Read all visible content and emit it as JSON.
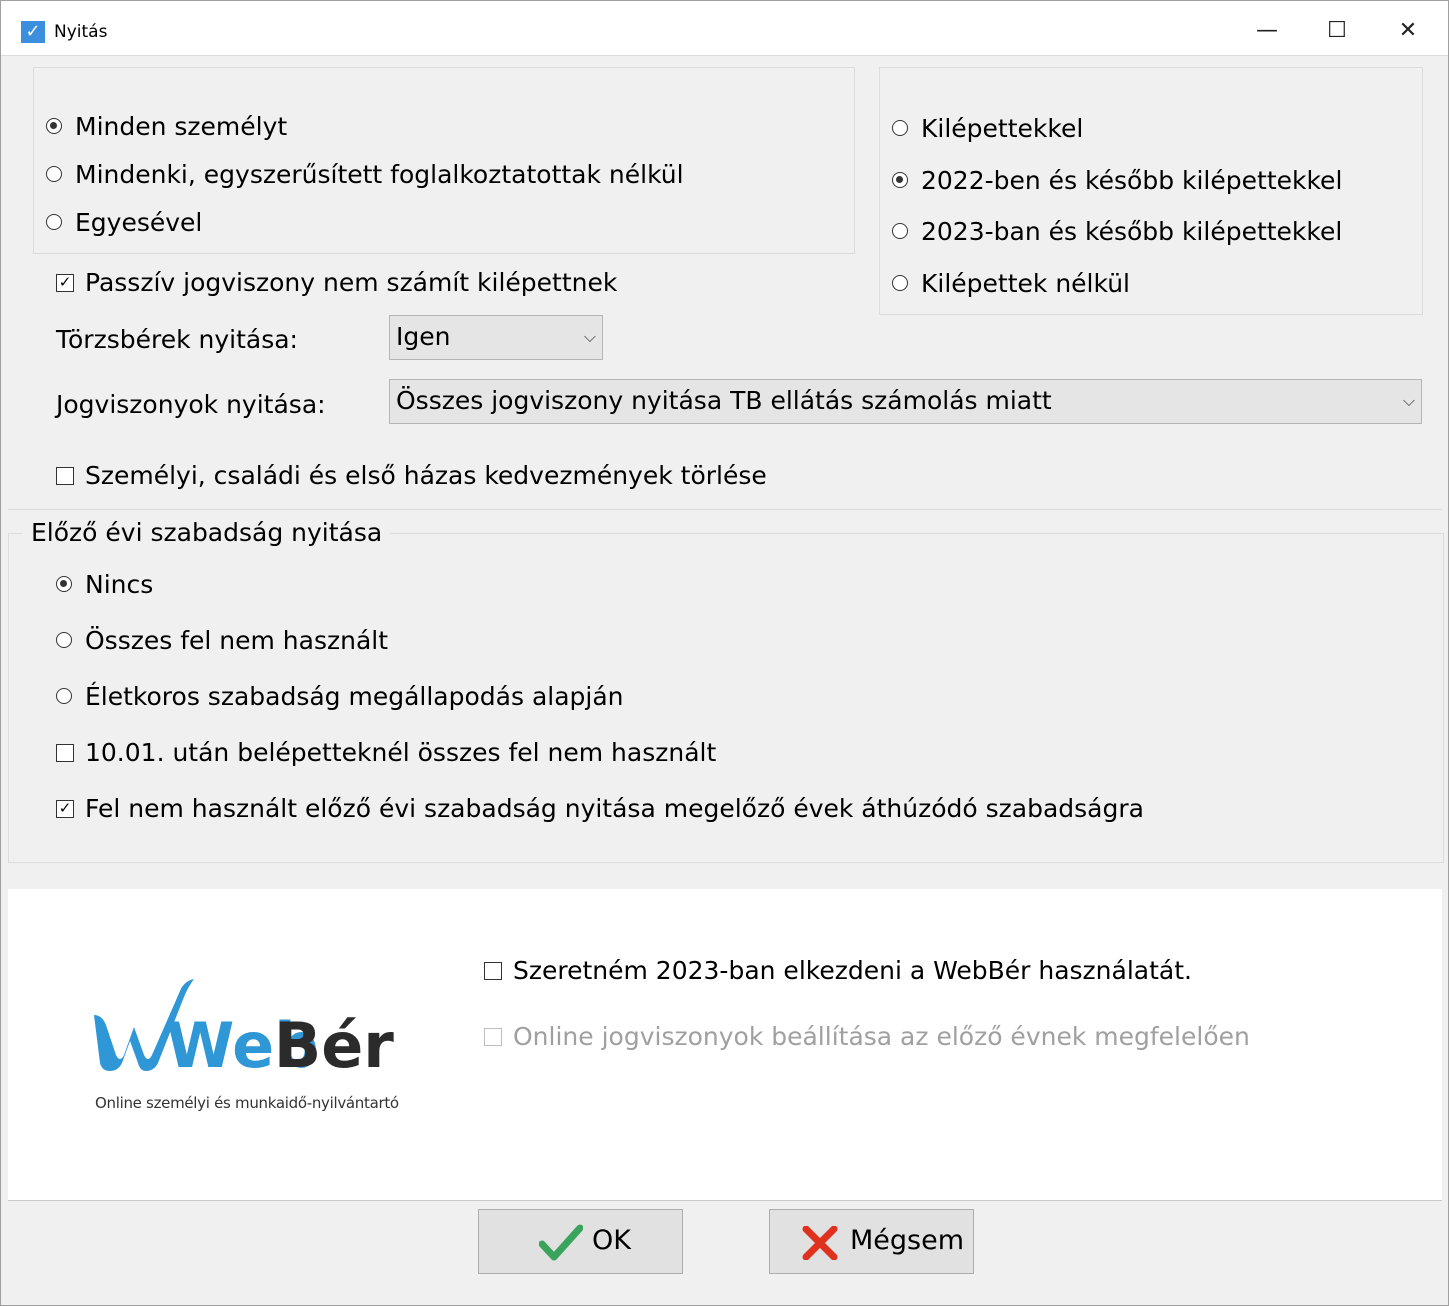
{
  "window": {
    "title": "Nyitás",
    "app_icon": "check-icon",
    "controls": {
      "minimize": "—",
      "maximize": "☐",
      "close": "✕"
    }
  },
  "person_scope": {
    "options": [
      "Minden személyt",
      "Mindenki, egyszerűsített foglalkoztatottak nélkül",
      "Egyesével"
    ],
    "selected_index": 0
  },
  "leavers": {
    "options": [
      "Kilépettekkel",
      "2022-ben és később kilépettekkel",
      "2023-ban és később kilépettekkel",
      "Kilépettek nélkül"
    ],
    "selected_index": 1
  },
  "passive_checkbox": {
    "label": "Passzív jogviszony nem számít kilépettnek",
    "checked": true
  },
  "torzsberek": {
    "label": "Törzsbérek nyitása:",
    "value": "Igen"
  },
  "jogviszonyok": {
    "label": "Jogviszonyok nyitása:",
    "value": "Összes jogviszony nyitása TB ellátás számolás miatt"
  },
  "delete_discounts_checkbox": {
    "label": "Személyi, családi és első házas kedvezmények törlése",
    "checked": false
  },
  "vacation": {
    "legend": "Előző évi szabadság nyitása",
    "options": [
      "Nincs",
      "Összes fel nem használt",
      "Életkoros szabadság megállapodás alapján"
    ],
    "selected_index": 0,
    "checkboxes": [
      {
        "label": "10.01. után belépetteknél összes fel nem használt",
        "checked": false
      },
      {
        "label": "Fel nem használt előző évi szabadság nyitása megelőző évek áthúzódó szabadságra",
        "checked": true
      }
    ]
  },
  "webber": {
    "logo_text_web": "Web",
    "logo_text_ber": "Bér",
    "logo_tagline": "Online személyi és munkaidő-nyilvántartó",
    "start_checkbox": {
      "label": "Szeretném 2023-ban elkezdeni a WebBér használatát.",
      "checked": false
    },
    "online_checkbox": {
      "label": "Online jogviszonyok beállítása az előző évnek megfelelően",
      "checked": false,
      "disabled": true
    },
    "colors": {
      "web": "#2f97d6",
      "ber": "#2b2b2b"
    }
  },
  "buttons": {
    "ok": {
      "label": "OK",
      "icon": "check-icon",
      "color": "#3aa35c"
    },
    "cancel": {
      "label": "Mégsem",
      "icon": "x-icon",
      "color": "#e0301e"
    }
  }
}
